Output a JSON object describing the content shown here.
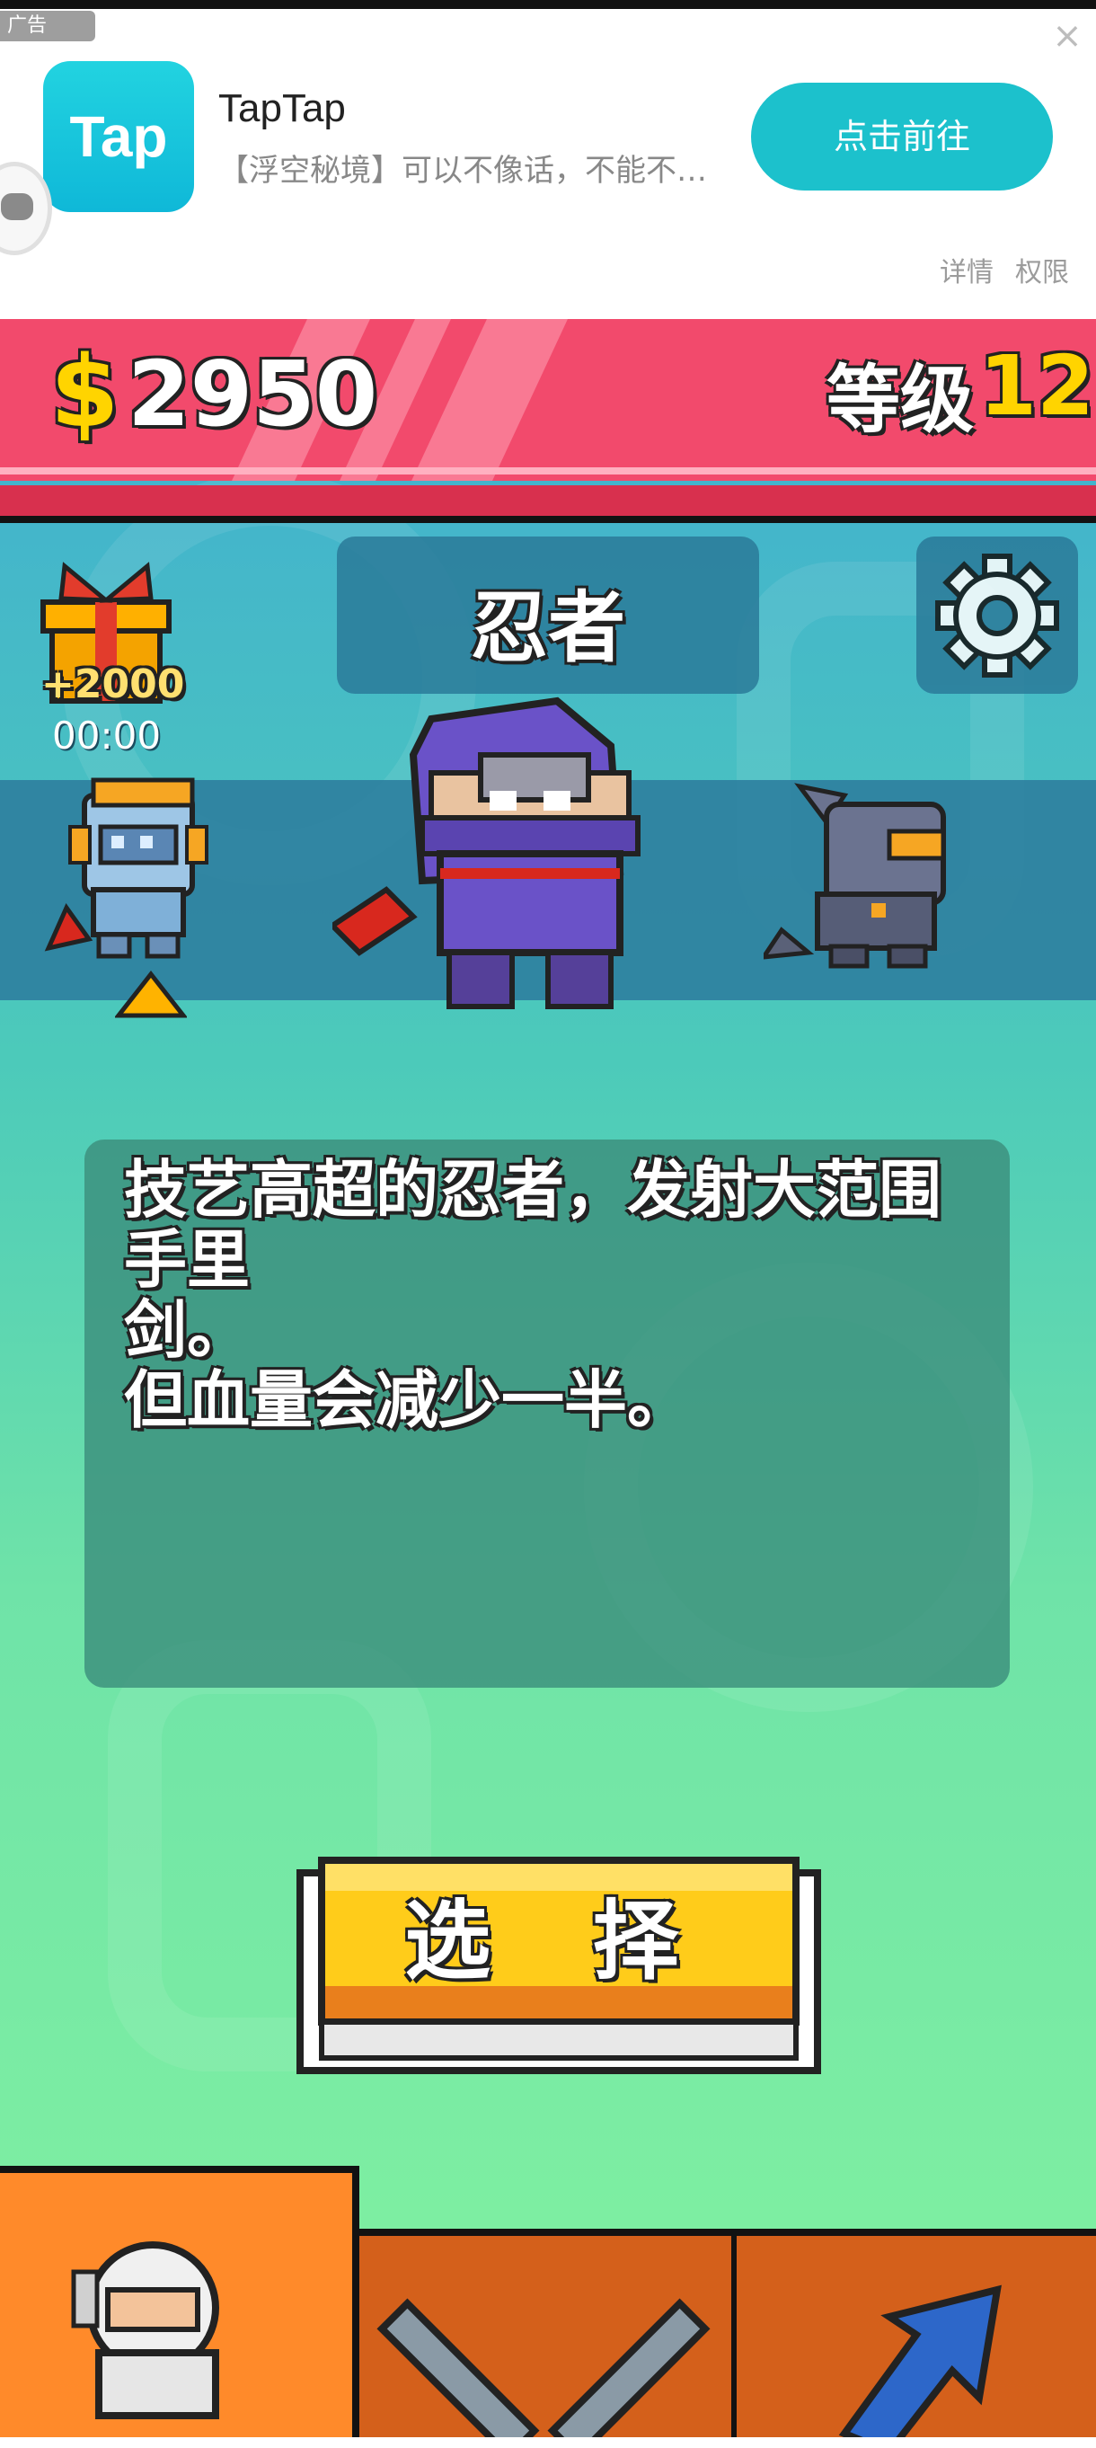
{
  "ad": {
    "tag": "广告",
    "app_name": "TapTap",
    "logo_text": "Tap",
    "description": "【浮空秘境】可以不像话，不能不…",
    "cta": "点击前往",
    "detail": "详情",
    "permissions": "权限"
  },
  "hud": {
    "currency_symbol": "$",
    "coins": "2950",
    "level_label": "等级",
    "level_value": "12"
  },
  "gift": {
    "bonus": "+2000",
    "timer": "00:00"
  },
  "character": {
    "name": "忍者",
    "description_lines": [
      "技艺高超的忍者，发射大范围手里",
      "剑。",
      "但血量会减少一半。"
    ]
  },
  "select_button": "选 择",
  "tabs": [
    "heroes-tab",
    "weapons-tab",
    "upgrade-tab"
  ],
  "colors": {
    "hud_bar": "#f24a6c",
    "accent_gold": "#ffd400",
    "ad_cta": "#1cc1cc",
    "tab_active": "#ff8a2a",
    "tab_inactive": "#d4601b"
  }
}
